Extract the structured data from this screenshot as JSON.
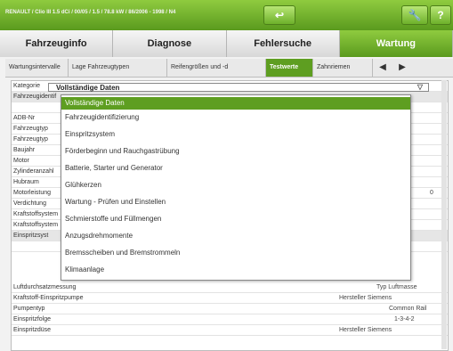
{
  "window": {
    "title": "RENAULT / Clio III 1.5 dCi / 00/05 / 1.5 / 78.8 kW / 86/2006 - 1998 / N4",
    "buttons": [
      "back-arrow-icon",
      "wrench-icon",
      "help-icon"
    ],
    "help_label": "?"
  },
  "main_tabs": [
    {
      "label": "Fahrzeuginfo"
    },
    {
      "label": "Diagnose"
    },
    {
      "label": "Fehlersuche"
    },
    {
      "label": "Wartung"
    }
  ],
  "sub_tabs": [
    {
      "label": "Wartungsintervalle"
    },
    {
      "label": "Lage Fahrzeugtypen"
    },
    {
      "label": "Reifengrößen und -d"
    },
    {
      "label": "Testwerte"
    },
    {
      "label": "Zahnriemen"
    }
  ],
  "nav": {
    "prev": "◀",
    "next": "▶"
  },
  "kategorie": {
    "label": "Kategorie",
    "value": "Vollständige Daten"
  },
  "dropdown_options": [
    "Vollständige Daten",
    "Fahrzeugidentifizierung",
    "Einspritzsystem",
    "Förderbeginn und Rauchgastrübung",
    "Batterie, Starter und Generator",
    "Glühkerzen",
    "Wartung - Prüfen und Einstellen",
    "Schmierstoffe und Füllmengen",
    "Anzugsdrehmomente",
    "Bremsscheiben und Bremstrommeln",
    "Klimaanlage"
  ],
  "table_rows": [
    {
      "label": "Fahrzeugidentif",
      "mid": "",
      "value": ""
    },
    {
      "label": "",
      "mid": "",
      "value": ""
    },
    {
      "label": "ADB-Nr",
      "mid": "",
      "value": ""
    },
    {
      "label": "Fahrzeugtyp",
      "mid": "",
      "value": ""
    },
    {
      "label": "Fahrzeugtyp",
      "mid": "",
      "value": ""
    },
    {
      "label": "Baujahr",
      "mid": "",
      "value": ""
    },
    {
      "label": "Motor",
      "mid": "",
      "value": ""
    },
    {
      "label": "Zylinderanzahl",
      "mid": "",
      "value": ""
    },
    {
      "label": "Hubraum",
      "mid": "",
      "value": ""
    },
    {
      "label": "Motorleistung",
      "mid": "",
      "value": "0"
    },
    {
      "label": "Verdichtung",
      "mid": "",
      "value": ""
    },
    {
      "label": "Kraftstoffsystem",
      "mid": "",
      "value": ""
    },
    {
      "label": "Kraftstoffsystem",
      "mid": "",
      "value": ""
    },
    {
      "label": "Einspritzsyst",
      "mid": "",
      "value": ""
    },
    {
      "label": "",
      "mid": "",
      "value": ""
    },
    {
      "label": "Luftdurchsatzmessung",
      "mid": "",
      "value": "Typ Luftmasse"
    },
    {
      "label": "Kraftstoff-Einspritzpumpe",
      "mid": "Hersteller Siemens",
      "value": ""
    },
    {
      "label": "Pumpentyp",
      "mid": "",
      "value": "Common Rail"
    },
    {
      "label": "Einspritzfolge",
      "mid": "",
      "value": "1-3-4-2"
    },
    {
      "label": "Einspritzdüse",
      "mid": "Hersteller Siemens",
      "value": ""
    }
  ]
}
